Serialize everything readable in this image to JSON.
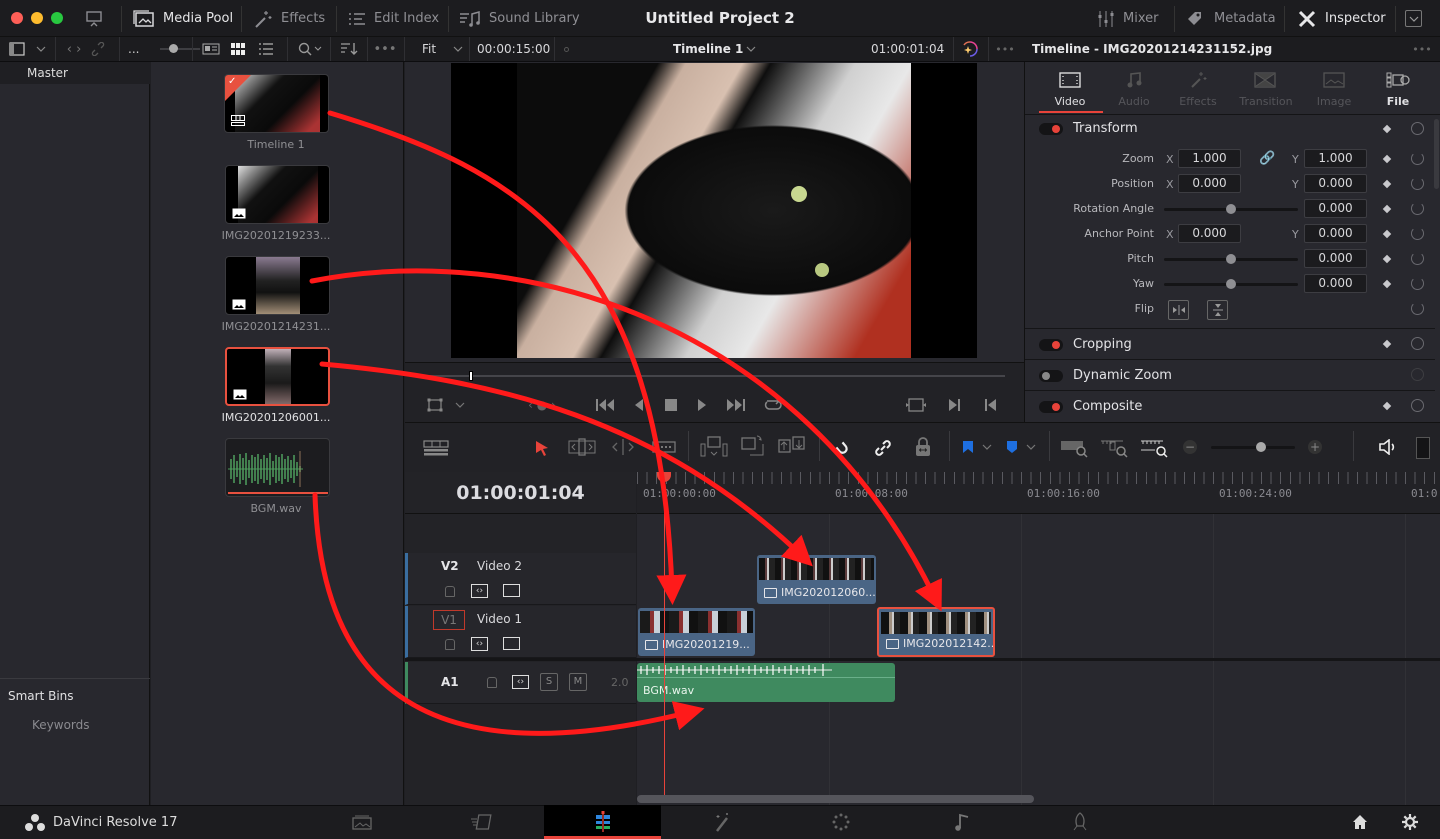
{
  "window": {
    "title": "Untitled Project 2"
  },
  "topbar": {
    "left_items": [
      {
        "label": "Media Pool",
        "icon": "media-pool-icon",
        "active": true
      },
      {
        "label": "Effects",
        "icon": "effects-icon",
        "active": false
      },
      {
        "label": "Edit Index",
        "icon": "edit-index-icon",
        "active": false
      },
      {
        "label": "Sound Library",
        "icon": "sound-library-icon",
        "active": false
      }
    ],
    "right_items": [
      {
        "label": "Mixer",
        "icon": "mixer-icon",
        "active": false
      },
      {
        "label": "Metadata",
        "icon": "metadata-icon",
        "active": false
      },
      {
        "label": "Inspector",
        "icon": "inspector-icon",
        "active": true
      }
    ]
  },
  "subbar": {
    "ellipsis": "...",
    "zoom_mode": "Fit",
    "duration": "00:00:15:00",
    "timeline_name": "Timeline 1",
    "timecode": "01:00:01:04",
    "inspector_title": "Timeline - IMG20201214231152.jpg"
  },
  "bins": {
    "master": "Master",
    "smart_bins": "Smart Bins",
    "keywords": "Keywords"
  },
  "media_pool": {
    "items": [
      {
        "label": "Timeline 1",
        "type": "timeline",
        "selected": false
      },
      {
        "label": "IMG20201219233...",
        "type": "image",
        "selected": false
      },
      {
        "label": "IMG20201214231...",
        "type": "image",
        "selected": false
      },
      {
        "label": "IMG20201206001...",
        "type": "image",
        "selected": true
      },
      {
        "label": "BGM.wav",
        "type": "audio",
        "selected": false
      }
    ]
  },
  "inspector": {
    "tabs": [
      {
        "label": "Video",
        "active": true
      },
      {
        "label": "Audio",
        "active": false
      },
      {
        "label": "Effects",
        "active": false
      },
      {
        "label": "Transition",
        "active": false
      },
      {
        "label": "Image",
        "active": false
      },
      {
        "label": "File",
        "active": false
      }
    ],
    "transform": {
      "title": "Transform",
      "zoom": {
        "label": "Zoom",
        "x": "1.000",
        "y": "1.000"
      },
      "position": {
        "label": "Position",
        "x": "0.000",
        "y": "0.000"
      },
      "rotation": {
        "label": "Rotation Angle",
        "value": "0.000",
        "slider": 0.5
      },
      "anchor": {
        "label": "Anchor Point",
        "x": "0.000",
        "y": "0.000"
      },
      "pitch": {
        "label": "Pitch",
        "value": "0.000",
        "slider": 0.5
      },
      "yaw": {
        "label": "Yaw",
        "value": "0.000",
        "slider": 0.5
      },
      "flip": {
        "label": "Flip"
      }
    },
    "sections": [
      {
        "title": "Cropping",
        "enabled": true
      },
      {
        "title": "Dynamic Zoom",
        "enabled": false
      },
      {
        "title": "Composite",
        "enabled": true
      }
    ],
    "x_label": "X",
    "y_label": "Y"
  },
  "timeline": {
    "timecode": "01:00:01:04",
    "zoom_slider": 0.6,
    "ruler_labels": [
      "01:00:00:00",
      "01:00:08:00",
      "01:00:16:00",
      "01:00:24:00",
      "01:0"
    ],
    "tracks": [
      {
        "id": "V2",
        "name": "Video 2",
        "clips": [
          {
            "label": "IMG202012060..."
          }
        ]
      },
      {
        "id": "V1",
        "name": "Video 1",
        "clips": [
          {
            "label": "IMG20201219..."
          },
          {
            "label": "IMG202012142..."
          }
        ]
      },
      {
        "id": "A1",
        "name": "",
        "level": "2.0",
        "clips": [
          {
            "label": "BGM.wav"
          }
        ]
      }
    ],
    "solo": "S",
    "mute": "M"
  },
  "pagebar": {
    "app_name": "DaVinci Resolve 17",
    "pages": [
      "media",
      "cut",
      "edit",
      "fusion",
      "color",
      "fairlight",
      "deliver"
    ],
    "active_page": "edit"
  },
  "colors": {
    "accent": "#e8433a",
    "clip_video": "#4a6585",
    "clip_audio": "#3f8a5f",
    "marker_blue": "#1e6fe0"
  }
}
